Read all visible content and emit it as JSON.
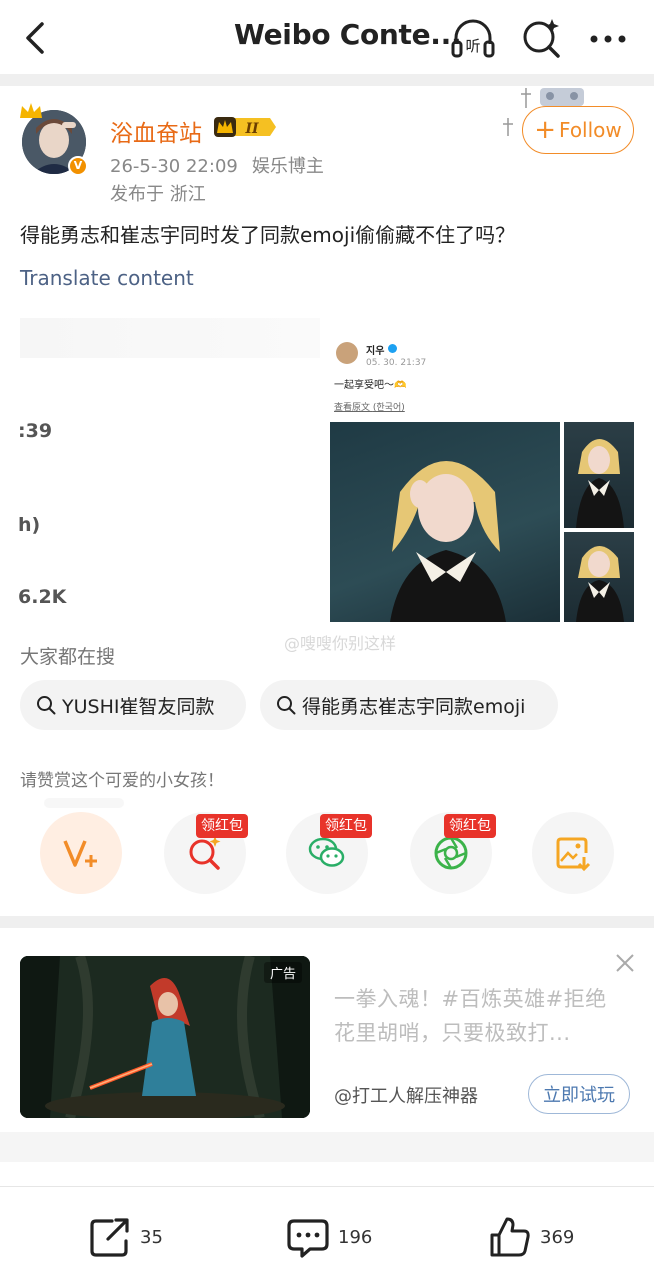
{
  "topbar": {
    "title": "Weibo Conte...",
    "back_icon": "chevron-left-icon",
    "listen_label": "听",
    "search_icon": "search-sparkle-icon",
    "more_icon": "more-horizontal-icon"
  },
  "post": {
    "username": "浴血奋站",
    "level_badge": "II",
    "date": "26-5-30 22:09",
    "category": "娱乐博主",
    "location": "发布于 浙江",
    "follow_label": "Follow",
    "text": "得能勇志和崔志宇同时发了同款emoji偷偷藏不住了吗？",
    "translate_label": "Translate content",
    "left_panel_fragments": [
      ":39",
      "h)",
      "6.2K"
    ],
    "embedded": {
      "name": "지우",
      "time": "05. 30. 21:37",
      "text": "一起享受吧～🫶",
      "original_link": "查看原文",
      "original_lang": "(한국어)"
    },
    "watermark": "@嗖嗖你别这样"
  },
  "search": {
    "label": "大家都在搜",
    "chips": [
      "YUSHI崔智友同款",
      "得能勇志崔志宇同款emoji"
    ]
  },
  "reward": {
    "text": "请赞赏这个可爱的小女孩！",
    "redpack_label": "领红包"
  },
  "ad": {
    "tag": "广告",
    "title": "一拳入魂！#百炼英雄#拒绝花里胡哨，只要极致打...",
    "account": "@打工人解压神器",
    "cta": "立即试玩"
  },
  "bottom_bar": {
    "repost_count": "35",
    "comment_count": "196",
    "like_count": "369"
  },
  "colors": {
    "accent_orange": "#f28c28",
    "username_orange": "#e86a16",
    "link_blue": "#4d6285",
    "red_badge": "#e8332a"
  }
}
